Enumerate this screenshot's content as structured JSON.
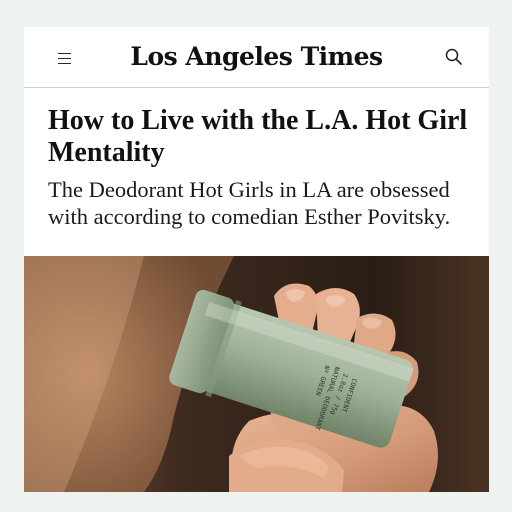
{
  "header": {
    "brand": "Los Angeles Times",
    "menu_icon": "hamburger-menu-icon",
    "search_icon": "search-icon"
  },
  "article": {
    "headline": "How to Live with the L.A. Hot Girl Mentality",
    "dek": "The Deodorant Hot Girls in LA are obsessed with according to comedian Esther Povitsky."
  },
  "image": {
    "subject": "hand-holding-deodorant-photo",
    "product_label_lines": [
      "Nº GREEN",
      "NATURAL DEODORANT",
      "2.8oz / 75g",
      "CONFIDENT"
    ]
  },
  "colors": {
    "page_background": "#eef3ef",
    "card_background": "#ffffff",
    "text": "#111111",
    "divider": "#cfcfcf"
  }
}
